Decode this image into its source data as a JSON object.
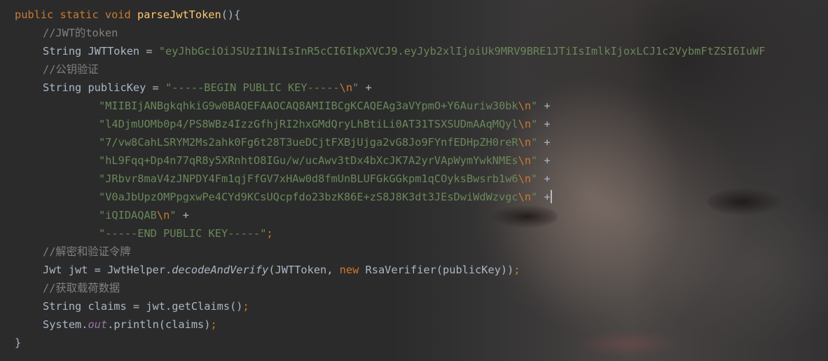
{
  "theme": {
    "background": "#2b2b2b",
    "text": "#a9b7c6",
    "keyword": "#cc7832",
    "method": "#ffc66d",
    "string": "#6a8759",
    "comment": "#808080",
    "field": "#9876aa"
  },
  "code": {
    "l1": {
      "kw": "public static void ",
      "name": "parseJwtToken",
      "tail": "(){"
    },
    "l2": {
      "comment": "//JWT的token"
    },
    "l3": {
      "decl": "String JWTToken = ",
      "str": "\"eyJhbGciOiJSUzI1NiIsInR5cCI6IkpXVCJ9.eyJyb2xlIjoiUk9MRV9BRE1JTiIsImlkIjoxLCJ1c2VybmFtZSI6IuWF"
    },
    "l4": {
      "comment": "//公钥验证"
    },
    "l5": {
      "decl": "String publicKey = ",
      "str": "\"-----BEGIN PUBLIC KEY-----",
      "esc": "\\n",
      "str_end": "\"",
      "tail": " +"
    },
    "l6": {
      "str": "\"MIIBIjANBgkqhkiG9w0BAQEFAAOCAQ8AMIIBCgKCAQEAg3aVYpmO+Y6Auriw30bk",
      "esc": "\\n",
      "str_end": "\"",
      "tail": " +"
    },
    "l7": {
      "str": "\"l4DjmUOMb0p4/PS8WBz4IzzGfhjRI2hxGMdQryLhBtiLi0AT31TSXSUDmAAqMQyl",
      "esc": "\\n",
      "str_end": "\"",
      "tail": " +"
    },
    "l8": {
      "str": "\"7/vw8CahLSRYM2Ms2ahk0Fg6t28T3ueDCjtFXBjUjga2vG8Jo9FYnfEDHpZH0reR",
      "esc": "\\n",
      "str_end": "\"",
      "tail": " +"
    },
    "l9": {
      "str": "\"hL9Fqq+Dp4n77qR8y5XRnhtO8IGu/w/ucAwv3tDx4bXcJK7A2yrVApWymYwkNMEs",
      "esc": "\\n",
      "str_end": "\"",
      "tail": " +"
    },
    "l10": {
      "str": "\"JRbvr8maV4zJNPDY4Fm1qjFfGV7xHAw0d8fmUnBLUFGkGGkpm1qCOyksBwsrb1w6",
      "esc": "\\n",
      "str_end": "\"",
      "tail": " +"
    },
    "l11": {
      "str": "\"V0aJbUpzOMPpgxwPe4CYd9KCsUQcpfdo23bzK86E+zS8J8K3dt3JEsDwiWdWzvgc",
      "esc": "\\n",
      "str_end": "\"",
      "tail": " +"
    },
    "l12": {
      "str": "\"iQIDAQAB",
      "esc": "\\n",
      "str_end": "\"",
      "tail": " +"
    },
    "l13": {
      "str": "\"-----END PUBLIC KEY-----\"",
      "tail": ";"
    },
    "l14": {
      "comment": "//解密和验证令牌"
    },
    "l15": {
      "decl": "Jwt jwt = JwtHelper.",
      "method": "decodeAndVerify",
      "args1": "(JWTToken, ",
      "kw": "new",
      "args2": " RsaVerifier(publicKey))",
      "tail": ";"
    },
    "l16": {
      "comment": "//获取载荷数据"
    },
    "l17": {
      "decl": "String claims = jwt.getClaims()",
      "tail": ";"
    },
    "l18": {
      "decl": "System.",
      "field": "out",
      "call": ".println(claims)",
      "tail": ";"
    },
    "l19": {
      "text": "}"
    }
  }
}
